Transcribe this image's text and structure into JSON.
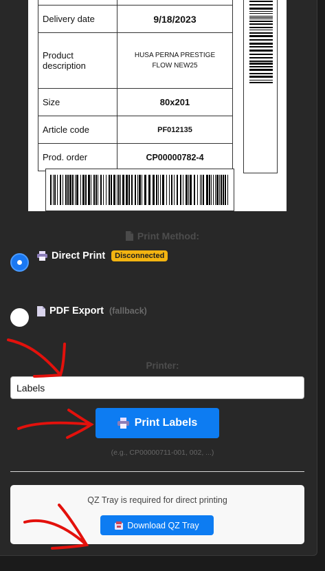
{
  "label": {
    "rows": [
      {
        "key": "Delivery date",
        "value": "9/18/2023"
      },
      {
        "key": "Product description",
        "value": "HUSA PERNA PRESTIGE FLOW NEW25"
      },
      {
        "key": "Size",
        "value": "80x201"
      },
      {
        "key": "Article code",
        "value": "PF012135"
      },
      {
        "key": "Prod. order",
        "value": "CP00000782-4"
      }
    ]
  },
  "print_method": {
    "title": "Print Method:",
    "direct": {
      "label": "Direct Print",
      "status": "Disconnected",
      "selected": true
    },
    "pdf": {
      "label": "PDF Export",
      "note": "(fallback)",
      "selected": false
    }
  },
  "printer": {
    "title": "Printer:",
    "value": "Labels"
  },
  "print_button": "Print Labels",
  "hint": "(e.g., CP00000711-001, 002, ...)",
  "qz": {
    "message": "QZ Tray is required for direct printing",
    "download": "Download QZ Tray"
  },
  "colors": {
    "accent": "#0d7cf2",
    "badge": "#f3b411",
    "annotation": "#e3110c"
  },
  "icons": [
    "document-icon",
    "printer-icon",
    "download-icon"
  ]
}
